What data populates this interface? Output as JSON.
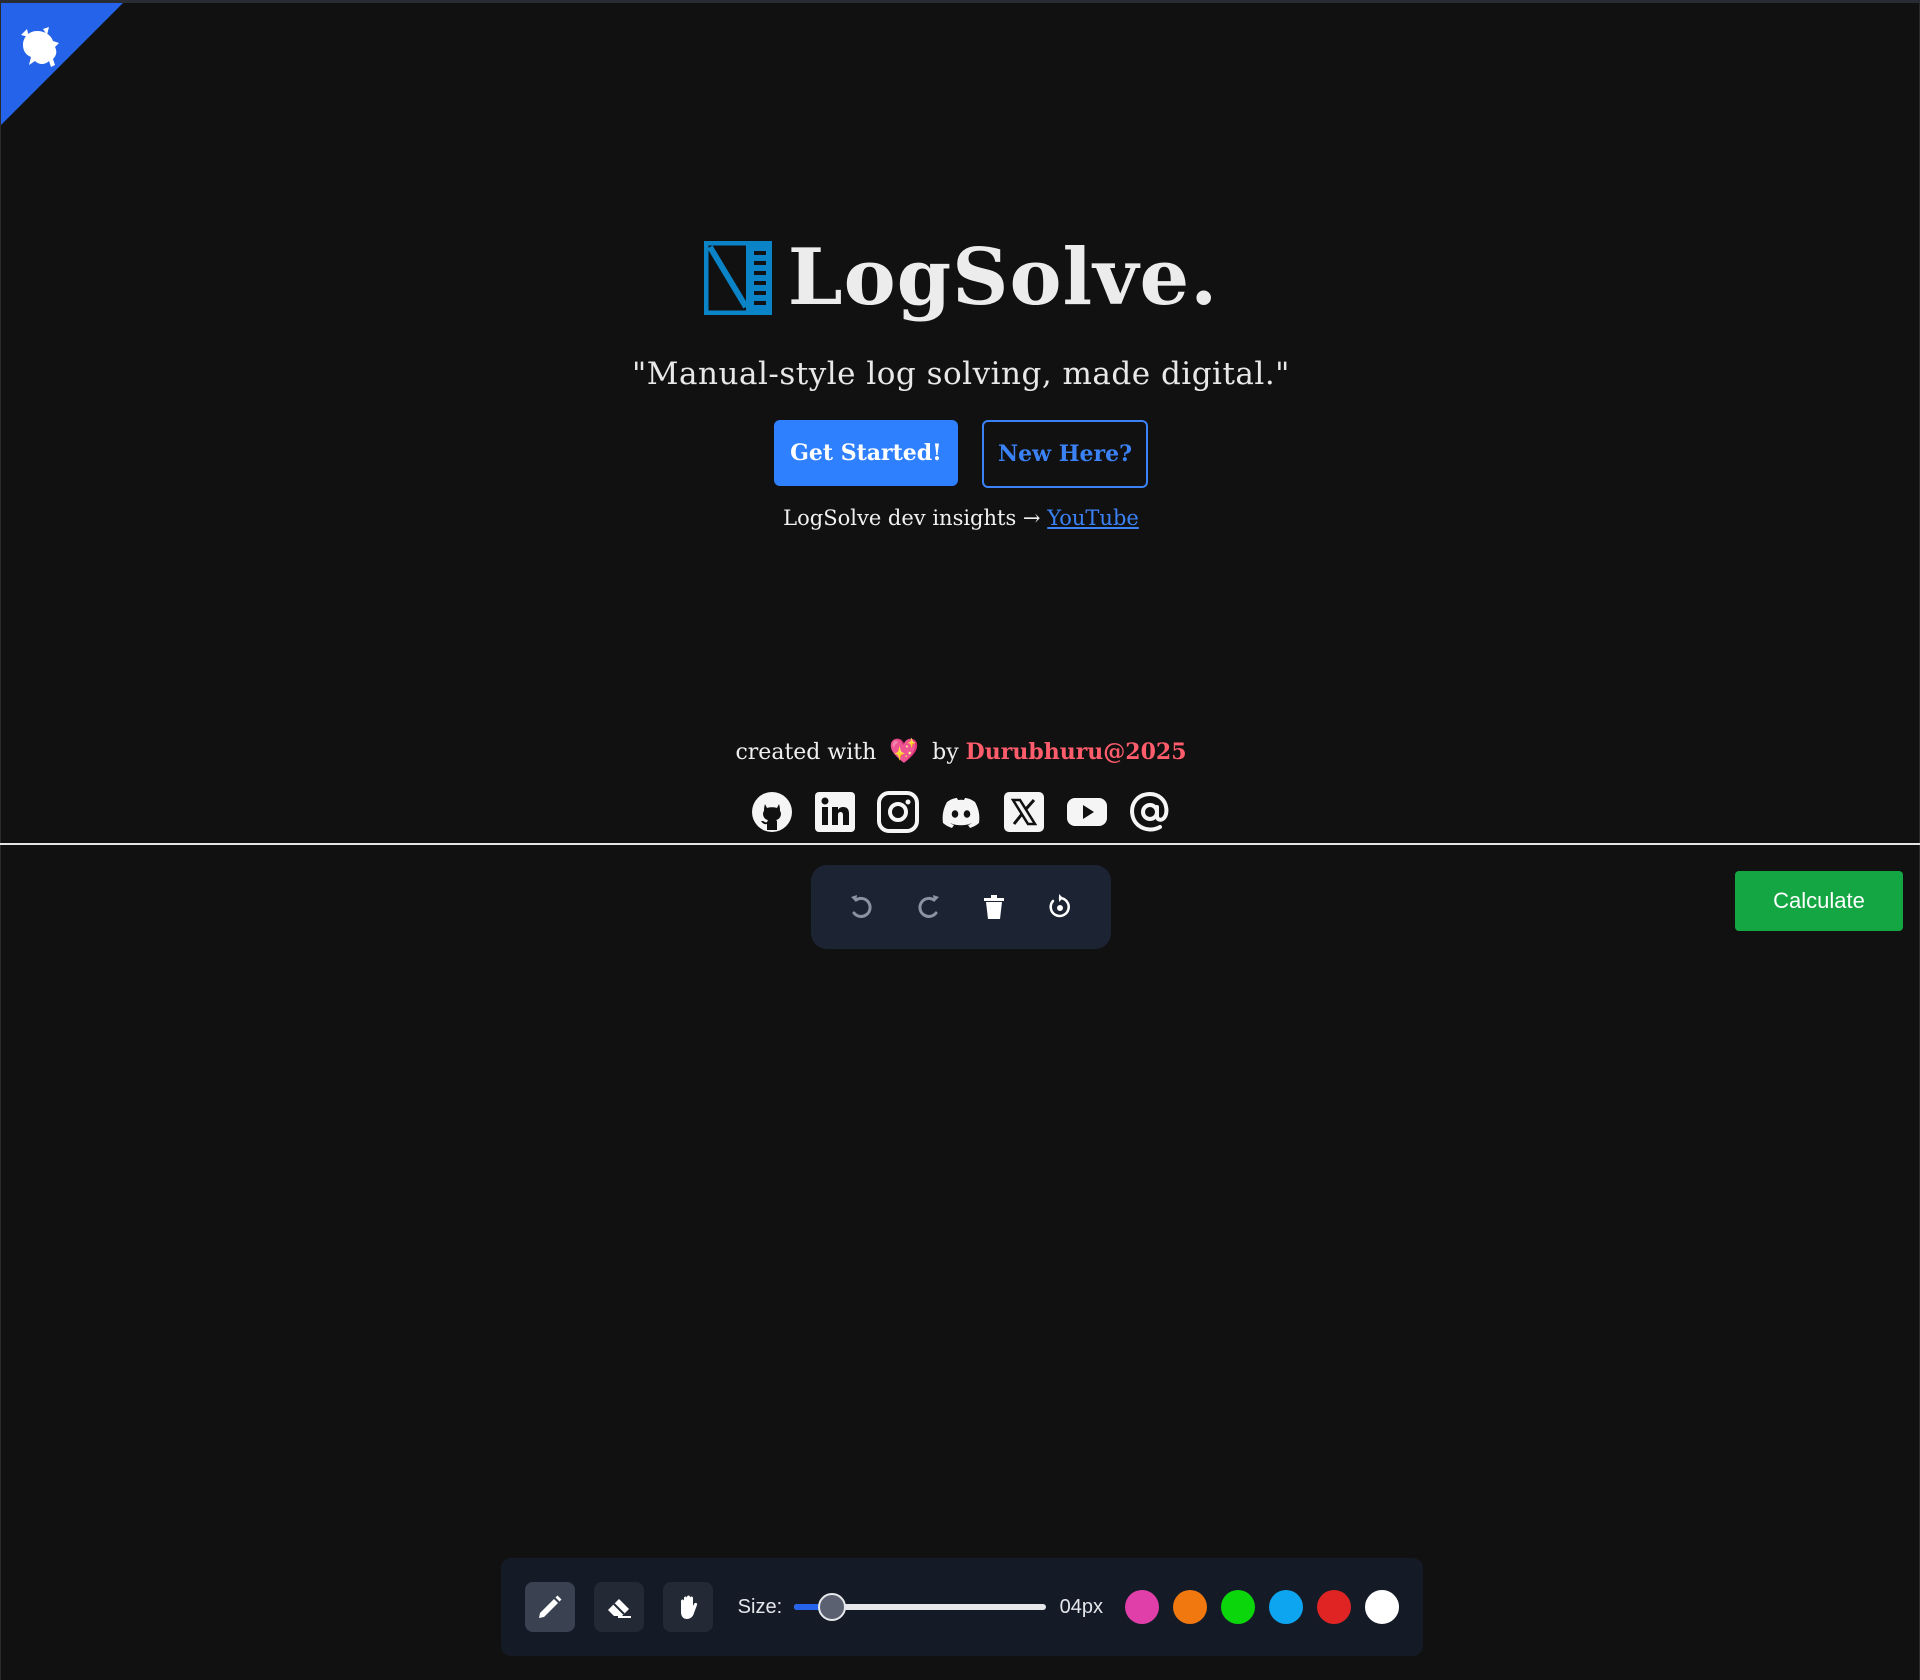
{
  "brand": {
    "title": "LogSolve.",
    "tagline": "\"Manual-style log solving, made digital.\"",
    "logo_icon": "notebook-ruler-icon",
    "accent": "#0a84c6"
  },
  "cta": {
    "primary_label": "Get Started!",
    "secondary_label": "New Here?"
  },
  "insights": {
    "text": "LogSolve dev insights → ",
    "link_label": "YouTube"
  },
  "credits": {
    "prefix": "created with",
    "heart": "💖",
    "by": "by",
    "author": "Durubhuru@2025"
  },
  "socials": [
    {
      "name": "github-icon"
    },
    {
      "name": "linkedin-icon"
    },
    {
      "name": "instagram-icon"
    },
    {
      "name": "discord-icon"
    },
    {
      "name": "x-icon"
    },
    {
      "name": "youtube-icon"
    },
    {
      "name": "email-at-icon"
    }
  ],
  "history": [
    {
      "name": "undo-icon"
    },
    {
      "name": "redo-icon"
    },
    {
      "name": "trash-icon"
    },
    {
      "name": "reset-icon"
    }
  ],
  "calculate_label": "Calculate",
  "toolbar": {
    "tools": [
      {
        "name": "pencil-icon",
        "active": true
      },
      {
        "name": "eraser-icon",
        "active": false
      },
      {
        "name": "hand-icon",
        "active": false
      }
    ],
    "size_label": "Size:",
    "size_value": "04px",
    "size_fraction": 0.08,
    "colors": [
      "#e03ea8",
      "#f0780f",
      "#0bd60b",
      "#0ea5f0",
      "#e02424",
      "#ffffff"
    ],
    "selected_color": "#ffffff"
  },
  "colors": {
    "primary": "#2f80ff",
    "success": "#13a642",
    "ribbon": "#2563eb",
    "author": "#ff5c6c"
  }
}
